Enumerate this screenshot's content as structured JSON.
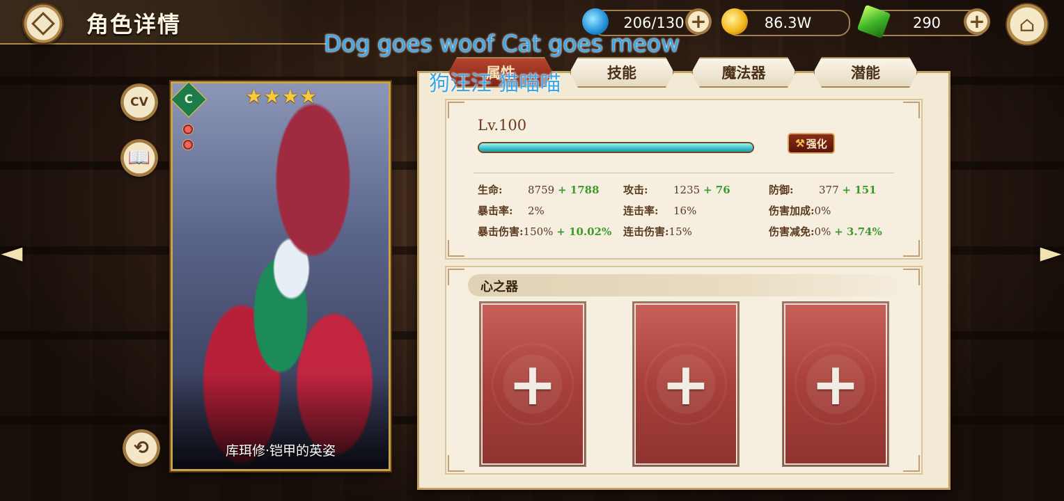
{
  "header": {
    "title": "角色详情",
    "stamina": "206/130",
    "gold": "86.3W",
    "gems": "290"
  },
  "overlay": {
    "english": "Dog goes woof Cat goes meow",
    "chinese": "狗汪汪 猫喵喵"
  },
  "tabs": [
    {
      "label": "属性",
      "active": true
    },
    {
      "label": "技能",
      "active": false
    },
    {
      "label": "魔法器",
      "active": false
    },
    {
      "label": "潜能",
      "active": false
    }
  ],
  "side_buttons": {
    "cv": "CV"
  },
  "card": {
    "name": "库珥修·铠甲的英姿",
    "stars": "★★★★",
    "emblem": "C",
    "star_count": 4
  },
  "stats_panel": {
    "level": "Lv.100",
    "exp_fraction": 1.0,
    "enhance_label": "强化",
    "stats": [
      {
        "label": "生命:",
        "value": "8759",
        "bonus": "+ 1788"
      },
      {
        "label": "攻击:",
        "value": "1235",
        "bonus": "+ 76"
      },
      {
        "label": "防御:",
        "value": "377",
        "bonus": "+ 151"
      },
      {
        "label": "暴击率:",
        "value": "2%",
        "bonus": ""
      },
      {
        "label": "连击率:",
        "value": "16%",
        "bonus": ""
      },
      {
        "label": "伤害加成:",
        "value": "0%",
        "bonus": ""
      },
      {
        "label": "暴击伤害:",
        "value": "150%",
        "bonus": "+ 10.02%"
      },
      {
        "label": "连击伤害:",
        "value": "15%",
        "bonus": ""
      },
      {
        "label": "伤害减免:",
        "value": "0%",
        "bonus": "+ 3.74%"
      }
    ]
  },
  "heart_section": {
    "title": "心之器",
    "slots": [
      "+",
      "+",
      "+"
    ]
  },
  "icons": {
    "back": "diamond-back-icon",
    "stamina": "water-drop-icon",
    "gold": "gold-coin-icon",
    "gem": "green-crystal-icon",
    "home": "home-icon",
    "book": "book-icon",
    "rotate": "rotate-card-icon"
  },
  "colors": {
    "bonus_green": "#3e9a2e",
    "active_tab": "#9e3424",
    "exp_bar": "#3cc0c8",
    "slot_red": "#a8403a"
  }
}
